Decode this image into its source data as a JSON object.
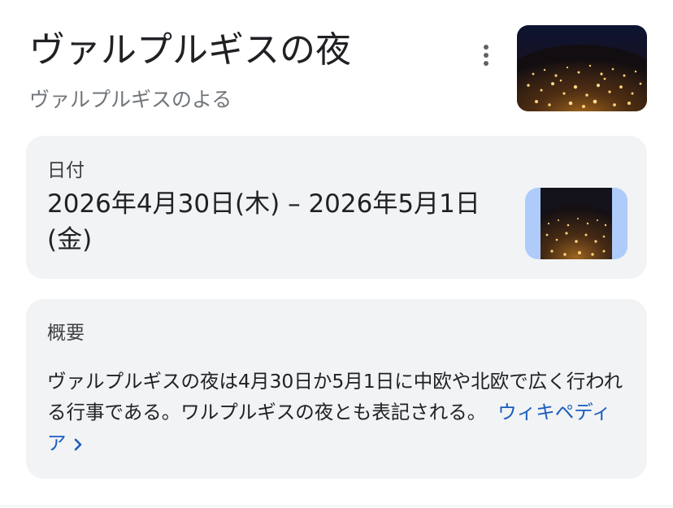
{
  "header": {
    "title": "ヴァルプルギスの夜",
    "subtitle": "ヴァルプルギスのよる",
    "more_icon": "more-vert-icon",
    "image_subject": "night-festival-lights"
  },
  "date_card": {
    "label": "日付",
    "value": "2026年4月30日(木) – 2026年5月1日(金)"
  },
  "summary_card": {
    "label": "概要",
    "text": "ヴァルプルギスの夜は4月30日か5月1日に中欧や北欧で広く行われる行事である。ワルプルギスの夜とも表記される。",
    "link_label": "ウィキペディア",
    "link_icon": "chevron-right-icon"
  },
  "colors": {
    "card_background": "#f1f3f4",
    "link": "#1a5cbf",
    "accent_thumb_bg": "#aecbfa"
  }
}
